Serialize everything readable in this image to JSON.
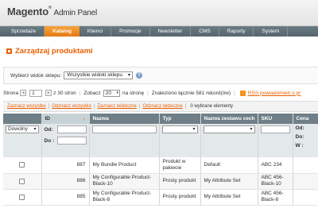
{
  "header": {
    "logo_main": "Magento",
    "logo_reg": "®",
    "logo_sub": "Admin Panel"
  },
  "nav": [
    {
      "label": "Sprzedaże",
      "active": false
    },
    {
      "label": "Katalog",
      "active": true
    },
    {
      "label": "Klienci",
      "active": false
    },
    {
      "label": "Promocje",
      "active": false
    },
    {
      "label": "Newsletter",
      "active": false
    },
    {
      "label": "CMS",
      "active": false
    },
    {
      "label": "Raporty",
      "active": false
    },
    {
      "label": "System",
      "active": false
    }
  ],
  "page": {
    "title": "Zarządzaj produktami",
    "title_icon": "products-icon"
  },
  "store_switcher": {
    "label": "Wybierz widok sklepu:",
    "value": "Wszystkie widoki sklepu",
    "help": "?"
  },
  "pager": {
    "strona_label": "Strona",
    "page_value": "1",
    "prev_arrow": "◂",
    "next_arrow": "▸",
    "of_pages": "z 30 stron",
    "show_label": "Zobacz",
    "limit_value": "20",
    "per_page": "na stronę",
    "found": "Znaleziono łącznie 581 rekord(ów)",
    "rss_text": "RSS powiadomień o pr"
  },
  "massaction": {
    "select_all": "Zaznacz wszystko",
    "unselect_all": "Odznacz wszystko",
    "select_visible": "Zaznacz widoczne",
    "unselect_visible": "Odznacz widoczne",
    "selected": "0 wybrane elementy"
  },
  "grid": {
    "columns": [
      "",
      "ID",
      "Nazwa",
      "Typ",
      "Nazwa zestawu cech",
      "SKU",
      "Cena"
    ],
    "sort_arrow": "↓",
    "filters": {
      "any": "Dowolny",
      "from_label": "Od:",
      "to_label": "Do :",
      "price_from": "Od:",
      "price_to": "Do:",
      "price_currency": "W :"
    },
    "rows": [
      {
        "id": "887",
        "name": "My Bundle Product",
        "type": "Produkt w pakiecie",
        "attrset": "Default",
        "sku": "ABC 234"
      },
      {
        "id": "886",
        "name": "My Configurable Product-Black-10",
        "type": "Prosty produkt",
        "attrset": "My Attribute Set",
        "sku": "ABC 456-Black-10"
      },
      {
        "id": "885",
        "name": "My Configurable Product-Black-8",
        "type": "Prosty produkt",
        "attrset": "My Attribute Set",
        "sku": "ABC 456-Black-8"
      }
    ]
  }
}
